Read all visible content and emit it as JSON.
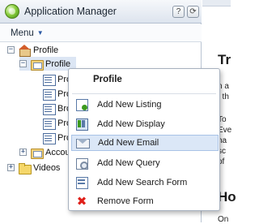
{
  "app": {
    "title": "Application Manager",
    "help_btn": "?",
    "refresh_btn": "⟳",
    "menu_label": "Menu",
    "menu_caret": "▼"
  },
  "tree": {
    "root": {
      "label": "Profile",
      "expander": "−"
    },
    "profile": {
      "label": "Profile",
      "expander": "−"
    },
    "children": [
      "Pro",
      "Pro",
      "Bro",
      "Pro",
      "Pro"
    ],
    "accounts": {
      "label": "Accou",
      "expander": "+"
    },
    "videos": {
      "label": "Videos",
      "expander": "+"
    }
  },
  "right_fragments": {
    "heading1": "Tr",
    "l1": "n a",
    "l2": "f th",
    "l3": "To",
    "l4": "Eve",
    "l5": "ha",
    "l6": "sc",
    "l7": "of",
    "heading2": "Ho",
    "l8": "On"
  },
  "context_menu": {
    "title": "Profile",
    "items": [
      {
        "label": "Add New Listing",
        "icon": "add-listing-icon"
      },
      {
        "label": "Add New Display",
        "icon": "display-icon"
      },
      {
        "label": "Add New Email",
        "icon": "email-icon"
      },
      {
        "label": "Add New Query",
        "icon": "query-icon"
      },
      {
        "label": "Add New Search Form",
        "icon": "search-form-icon"
      },
      {
        "label": "Remove Form",
        "icon": "remove-icon"
      }
    ],
    "remove_glyph": "✖"
  },
  "colors": {
    "selection": "#dce6f4",
    "menu_highlight": "#dbe7f7",
    "remove_red": "#e0201a",
    "accent_green": "#3c9a1e"
  }
}
